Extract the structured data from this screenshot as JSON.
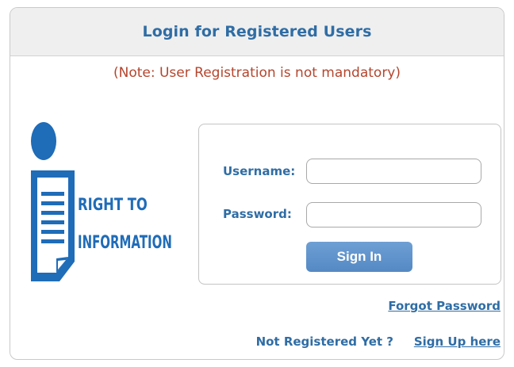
{
  "header": {
    "title": "Login for Registered Users"
  },
  "note": "(Note: User Registration is not mandatory)",
  "logo": {
    "line1": "RIGHT TO",
    "line2": "INFORMATION",
    "color": "#1f6cb8",
    "icon": "person-document-icon"
  },
  "form": {
    "username_label": "Username:",
    "username_value": "",
    "password_label": "Password:",
    "password_value": "",
    "signin_label": "Sign In"
  },
  "links": {
    "forgot_password": "Forgot Password",
    "not_registered": "Not Registered Yet ?",
    "sign_up": "Sign Up here"
  },
  "colors": {
    "title": "#2f6da5",
    "note": "#b5452d",
    "button": "#5e93cc"
  }
}
